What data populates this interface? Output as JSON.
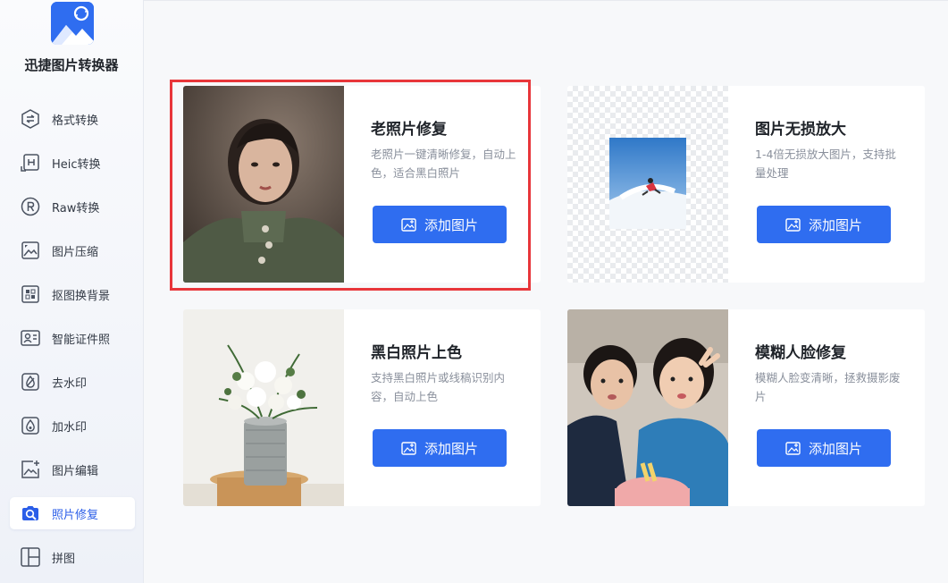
{
  "app": {
    "name": "迅捷图片转换器"
  },
  "sidebar": {
    "items": [
      {
        "label": "格式转换",
        "icon": "format-convert-icon",
        "active": false
      },
      {
        "label": "Heic转换",
        "icon": "heic-icon",
        "active": false
      },
      {
        "label": "Raw转换",
        "icon": "raw-icon",
        "active": false
      },
      {
        "label": "图片压缩",
        "icon": "image-compress-icon",
        "active": false
      },
      {
        "label": "抠图换背景",
        "icon": "cutout-icon",
        "active": false
      },
      {
        "label": "智能证件照",
        "icon": "id-photo-icon",
        "active": false
      },
      {
        "label": "去水印",
        "icon": "remove-watermark-icon",
        "active": false
      },
      {
        "label": "加水印",
        "icon": "add-watermark-icon",
        "active": false
      },
      {
        "label": "图片编辑",
        "icon": "image-edit-icon",
        "active": false
      },
      {
        "label": "照片修复",
        "icon": "photo-repair-icon",
        "active": true
      },
      {
        "label": "拼图",
        "icon": "collage-icon",
        "active": false
      }
    ]
  },
  "cards": [
    {
      "title": "老照片修复",
      "desc": "老照片一键清晰修复，自动上色，适合黑白照片",
      "button": "添加图片",
      "highlighted": true
    },
    {
      "title": "图片无损放大",
      "desc": "1-4倍无损放大图片，支持批量处理",
      "button": "添加图片",
      "highlighted": false
    },
    {
      "title": "黑白照片上色",
      "desc": "支持黑白照片或线稿识别内容，自动上色",
      "button": "添加图片",
      "highlighted": false
    },
    {
      "title": "模糊人脸修复",
      "desc": "模糊人脸变清晰，拯救摄影废片",
      "button": "添加图片",
      "highlighted": false
    }
  ],
  "colors": {
    "accent": "#2f6df0",
    "highlight_border": "#e8363a",
    "active_text": "#2b5ee8"
  }
}
